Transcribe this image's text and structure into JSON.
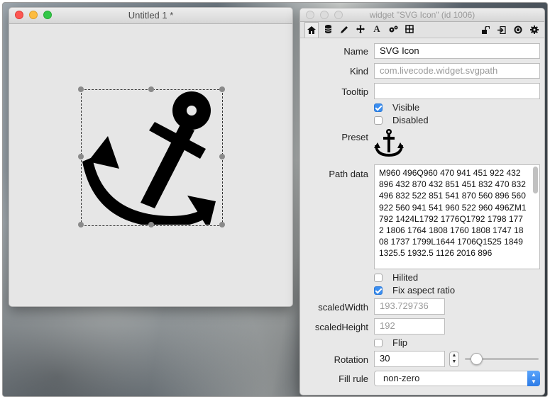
{
  "stack_window": {
    "title": "Untitled 1 *"
  },
  "inspector": {
    "title": "widget \"SVG Icon\" (id 1006)",
    "toolbar_left_icons": [
      "home-icon",
      "database-icon",
      "pencil-icon",
      "move-icon",
      "text-icon",
      "gears-icon",
      "grid-icon"
    ],
    "toolbar_right_icons": [
      "lock-icon",
      "exit-icon",
      "target-icon",
      "gear-icon"
    ],
    "labels": {
      "name": "Name",
      "kind": "Kind",
      "tooltip": "Tooltip",
      "preset": "Preset",
      "path_data": "Path data",
      "scaled_width": "scaledWidth",
      "scaled_height": "scaledHeight",
      "rotation": "Rotation",
      "fill_rule": "Fill rule"
    },
    "name_value": "SVG Icon",
    "kind_value": "com.livecode.widget.svgpath",
    "tooltip_value": "",
    "visible_label": "Visible",
    "visible_checked": true,
    "disabled_label": "Disabled",
    "disabled_checked": false,
    "preset_icon": "anchor-icon",
    "path_data_value": "M960 496Q960 470 941 451 922 432 896 432 870 432 851 451 832 470 832 496 832 522 851 541 870 560 896 560 922 560 941 541 960 522 960 496ZM1792 1424L1792 1776Q1792 1798 1772 1806 1764 1808 1760 1808 1747 1808 1737 1799L1644 1706Q1525 1849 1325.5 1932.5 1126 2016 896",
    "hilited_label": "Hilited",
    "hilited_checked": false,
    "fix_aspect_label": "Fix aspect ratio",
    "fix_aspect_checked": true,
    "scaled_width_value": "193.729736",
    "scaled_height_value": "192",
    "flip_label": "Flip",
    "flip_checked": false,
    "rotation_value": "30",
    "fill_rule_value": "non-zero"
  },
  "colors": {
    "checkbox_on": "#3b8ef0",
    "close": "#fc5753",
    "minimize": "#fdbc40",
    "maximize": "#33c748"
  }
}
